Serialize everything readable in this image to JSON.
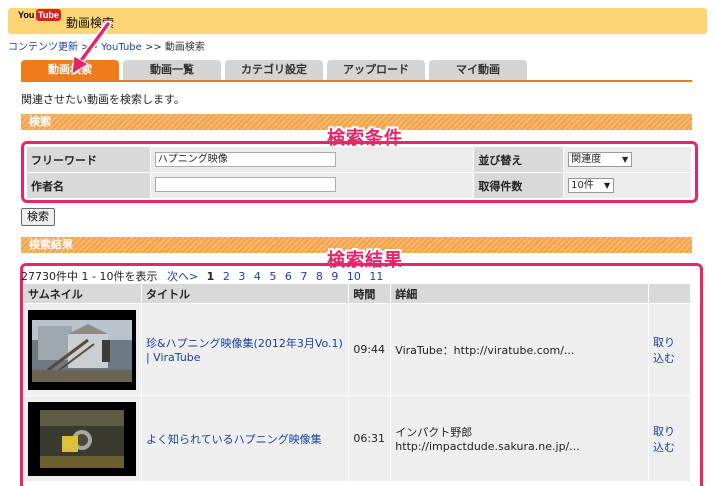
{
  "header": {
    "logo_you": "You",
    "logo_tube": "Tube",
    "title": "動画検索"
  },
  "breadcrumb": {
    "link1": "コンテンツ更新",
    "sep1": " >> ",
    "link2": "YouTube",
    "sep2": " >> ",
    "current": "動画検索"
  },
  "tabs": [
    {
      "label": "動画検索"
    },
    {
      "label": "動画一覧"
    },
    {
      "label": "カテゴリ設定"
    },
    {
      "label": "アップロード"
    },
    {
      "label": "マイ動画"
    }
  ],
  "intro": "関連させたい動画を検索します。",
  "search_section": {
    "title": "検索",
    "callout": "検索条件",
    "freeword_label": "フリーワード",
    "freeword_value": "ハプニング映像",
    "author_label": "作者名",
    "author_value": "",
    "sort_label": "並び替え",
    "sort_value": "関連度",
    "count_label": "取得件数",
    "count_value": "10件",
    "button": "検索"
  },
  "results_section": {
    "title": "検索結果",
    "callout": "検索結果",
    "summary": "27730件中 1 - 10件を表示",
    "next": "次へ>",
    "current_page": "1",
    "pages": [
      "2",
      "3",
      "4",
      "5",
      "6",
      "7",
      "8",
      "9",
      "10",
      "11"
    ],
    "columns": [
      "サムネイル",
      "タイトル",
      "時間",
      "詳細",
      ""
    ],
    "rows": [
      {
        "title": "珍&ハプニング映像集(2012年3月Vo.1) | ViraTube",
        "time": "09:44",
        "detail1": "ViraTube：http://viratube.com/...",
        "detail2": "",
        "action": "取り込む"
      },
      {
        "title": "よく知られているハプニング映像集",
        "time": "06:31",
        "detail1": "インパクト野郎",
        "detail2": "http://impactdude.sakura.ne.jp/...",
        "action": "取り込む"
      }
    ]
  },
  "colors": {
    "accent": "#f07b1d",
    "highlight": "#e8246a",
    "header": "#fcd674",
    "link": "#1a3fa3"
  }
}
